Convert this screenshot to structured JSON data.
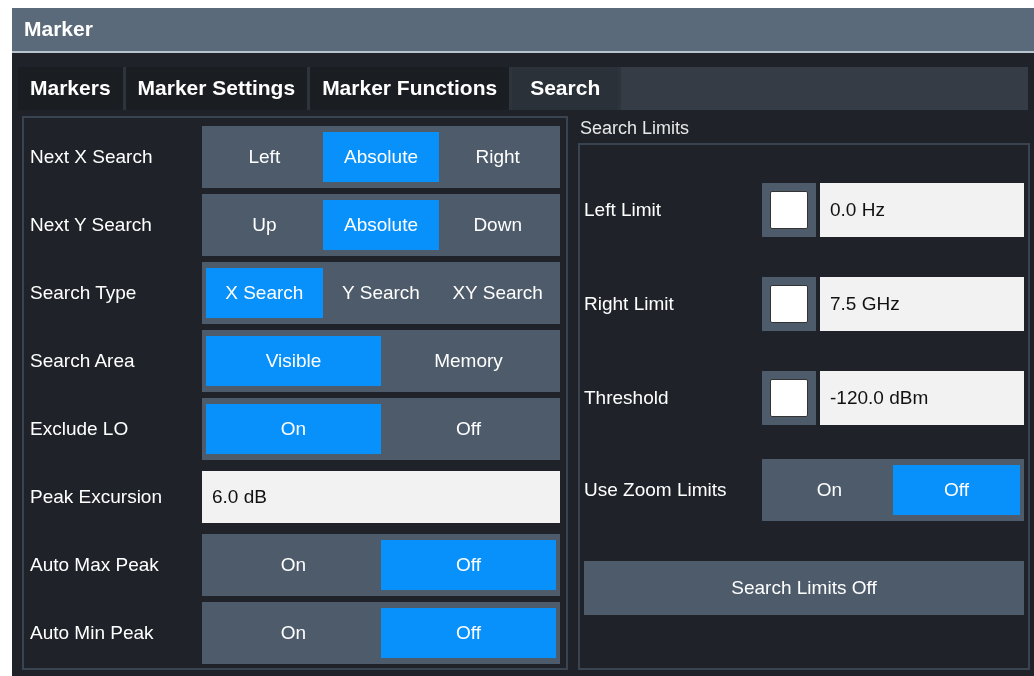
{
  "window": {
    "title": "Marker"
  },
  "tabs": [
    {
      "label": "Markers",
      "selected": false
    },
    {
      "label": "Marker Settings",
      "selected": false
    },
    {
      "label": "Marker Functions",
      "selected": false
    },
    {
      "label": "Search",
      "selected": true
    }
  ],
  "search_settings": [
    {
      "kind": "segmented",
      "label": "Next X Search",
      "options": [
        {
          "label": "Left",
          "selected": false
        },
        {
          "label": "Absolute",
          "selected": true
        },
        {
          "label": "Right",
          "selected": false
        }
      ]
    },
    {
      "kind": "segmented",
      "label": "Next Y Search",
      "options": [
        {
          "label": "Up",
          "selected": false
        },
        {
          "label": "Absolute",
          "selected": true
        },
        {
          "label": "Down",
          "selected": false
        }
      ]
    },
    {
      "kind": "segmented",
      "label": "Search Type",
      "options": [
        {
          "label": "X Search",
          "selected": true
        },
        {
          "label": "Y Search",
          "selected": false
        },
        {
          "label": "XY Search",
          "selected": false
        }
      ]
    },
    {
      "kind": "segmented",
      "label": "Search Area",
      "options": [
        {
          "label": "Visible",
          "selected": true
        },
        {
          "label": "Memory",
          "selected": false
        }
      ]
    },
    {
      "kind": "segmented",
      "label": "Exclude LO",
      "options": [
        {
          "label": "On",
          "selected": true
        },
        {
          "label": "Off",
          "selected": false
        }
      ]
    },
    {
      "kind": "field",
      "label": "Peak Excursion",
      "value": "6.0 dB"
    },
    {
      "kind": "segmented",
      "label": "Auto Max Peak",
      "options": [
        {
          "label": "On",
          "selected": false
        },
        {
          "label": "Off",
          "selected": true
        }
      ]
    },
    {
      "kind": "segmented",
      "label": "Auto Min Peak",
      "options": [
        {
          "label": "On",
          "selected": false
        },
        {
          "label": "Off",
          "selected": true
        }
      ]
    }
  ],
  "search_limits": {
    "title": "Search Limits",
    "limits": [
      {
        "label": "Left Limit",
        "checked": false,
        "value": "0.0 Hz"
      },
      {
        "label": "Right Limit",
        "checked": false,
        "value": "7.5 GHz"
      },
      {
        "label": "Threshold",
        "checked": false,
        "value": "-120.0 dBm"
      }
    ],
    "zoom_limits": {
      "label": "Use Zoom Limits",
      "options": [
        {
          "label": "On",
          "selected": false
        },
        {
          "label": "Off",
          "selected": true
        }
      ]
    },
    "button": "Search Limits Off"
  }
}
